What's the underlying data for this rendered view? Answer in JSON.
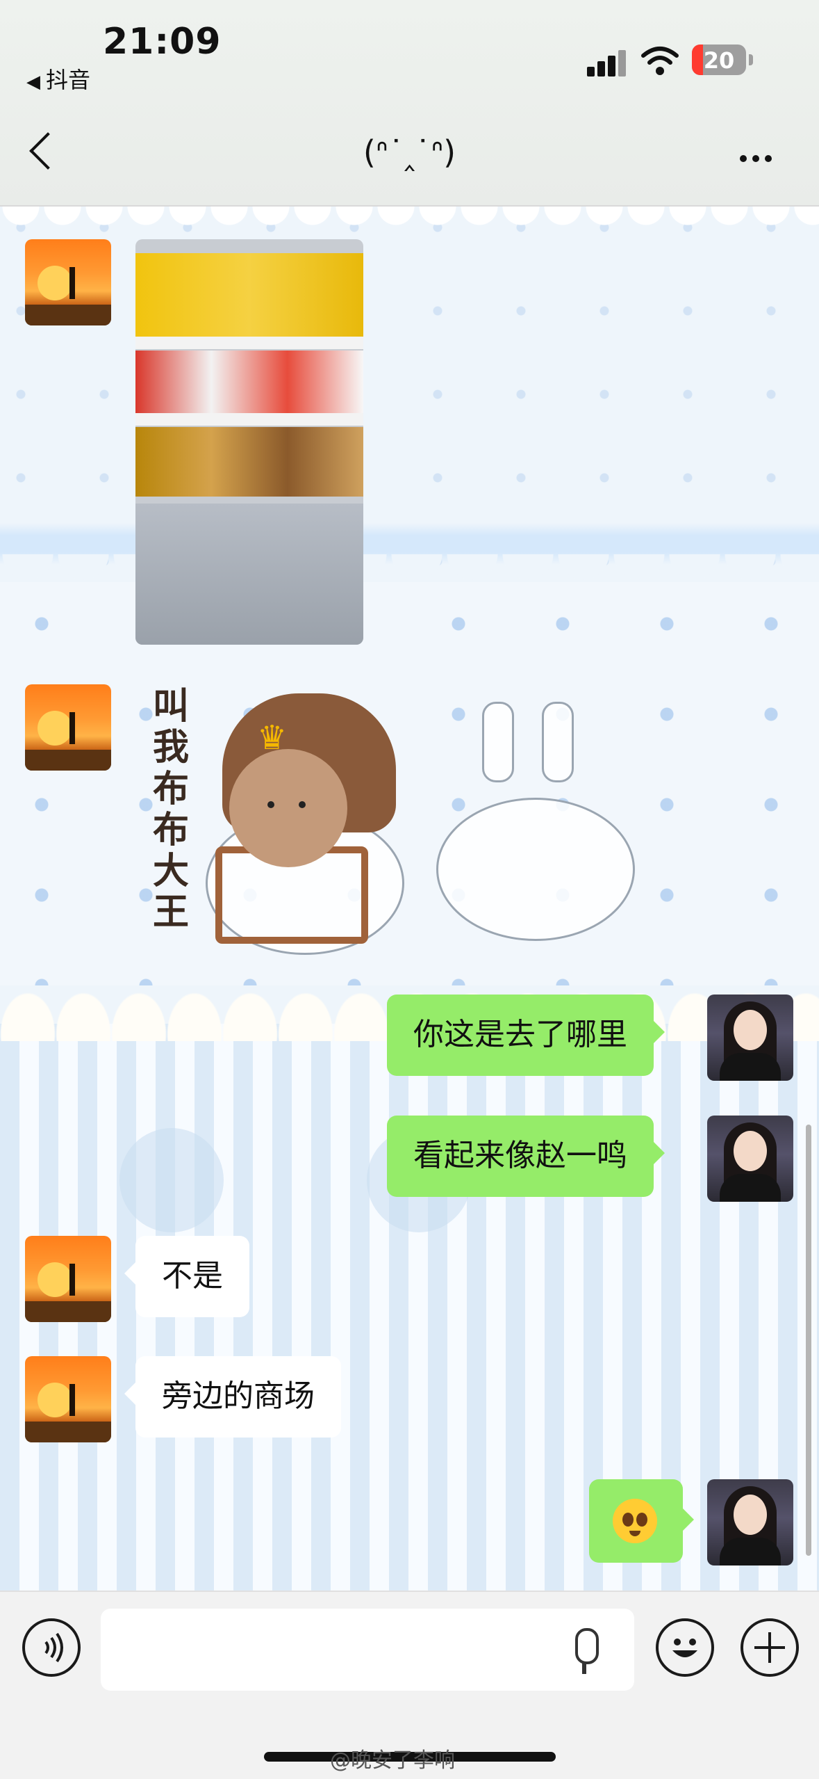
{
  "status_bar": {
    "time": "21:09",
    "back_app": "抖音",
    "battery_level": "20",
    "battery_fraction": 0.2,
    "battery_color": "#ff3b30"
  },
  "nav": {
    "title": "(ᐢ˙‸˙ᐢ)"
  },
  "messages": [
    {
      "side": "left",
      "type": "image",
      "description_icon": "shelf-photo"
    },
    {
      "side": "left",
      "type": "sticker",
      "sticker_text": "叫我布布大王"
    },
    {
      "side": "right",
      "type": "text",
      "text": "你这是去了哪里"
    },
    {
      "side": "right",
      "type": "text",
      "text": "看起来像赵一鸣"
    },
    {
      "side": "left",
      "type": "text",
      "text": "不是"
    },
    {
      "side": "left",
      "type": "text",
      "text": "旁边的商场"
    },
    {
      "side": "right",
      "type": "emoji",
      "emoji": "pleading-face"
    }
  ],
  "input_bar": {
    "placeholder": ""
  },
  "watermark": "@晚安了李响",
  "colors": {
    "bubble_self": "#95ec69",
    "bubble_other": "#ffffff",
    "input_background": "#f2f2f2"
  }
}
